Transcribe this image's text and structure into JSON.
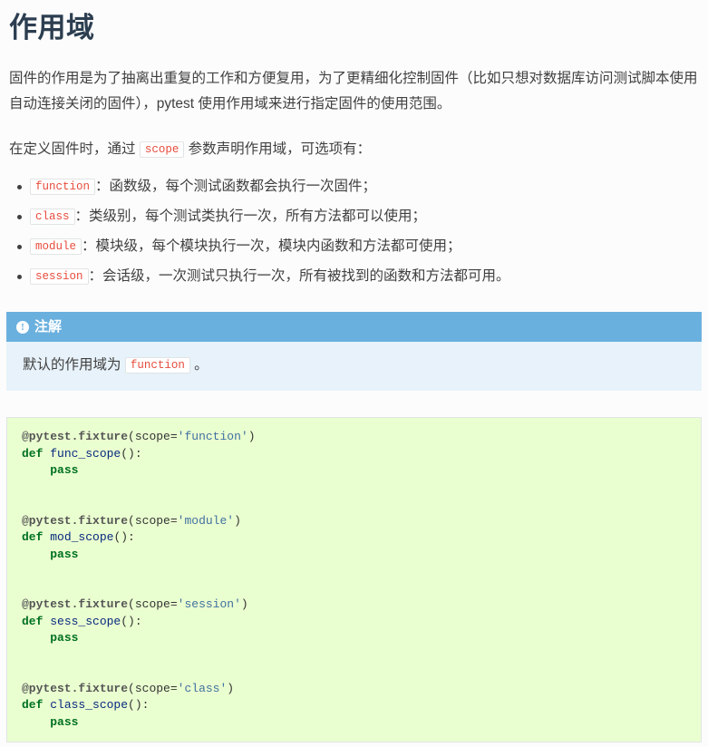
{
  "page": {
    "title": "作用域"
  },
  "intro": {
    "paragraph1": "固件的作用是为了抽离出重复的工作和方便复用，为了更精细化控制固件（比如只想对数据库访问测试脚本使用自动连接关闭的固件），pytest 使用作用域来进行指定固件的使用范围。",
    "paragraph2_before": "在定义固件时，通过",
    "paragraph2_code": "scope",
    "paragraph2_after": "参数声明作用域，可选项有："
  },
  "scope_list": [
    {
      "code": "function",
      "desc": "：函数级，每个测试函数都会执行一次固件；"
    },
    {
      "code": "class",
      "desc": "：类级别，每个测试类执行一次，所有方法都可以使用；"
    },
    {
      "code": "module",
      "desc": "：模块级，每个模块执行一次，模块内函数和方法都可使用；"
    },
    {
      "code": "session",
      "desc": "：会话级，一次测试只执行一次，所有被找到的函数和方法都可用。"
    }
  ],
  "note": {
    "icon": "exclamation-circle-icon",
    "title": "注解",
    "body_before": "默认的作用域为",
    "body_code": "function",
    "body_after": "。"
  },
  "code_block": {
    "language": "python",
    "lines": [
      {
        "tokens": [
          {
            "t": "@pytest.fixture",
            "k": "decorator"
          },
          {
            "t": "(",
            "k": "punct"
          },
          {
            "t": "scope",
            "k": "name"
          },
          {
            "t": "=",
            "k": "punct"
          },
          {
            "t": "'function'",
            "k": "string"
          },
          {
            "t": ")",
            "k": "punct"
          }
        ]
      },
      {
        "tokens": [
          {
            "t": "def",
            "k": "keyword"
          },
          {
            "t": " ",
            "k": "punct"
          },
          {
            "t": "func_scope",
            "k": "func"
          },
          {
            "t": "():",
            "k": "punct"
          }
        ]
      },
      {
        "tokens": [
          {
            "t": "    ",
            "k": "punct"
          },
          {
            "t": "pass",
            "k": "keyword"
          }
        ]
      },
      {
        "tokens": []
      },
      {
        "tokens": []
      },
      {
        "tokens": [
          {
            "t": "@pytest.fixture",
            "k": "decorator"
          },
          {
            "t": "(",
            "k": "punct"
          },
          {
            "t": "scope",
            "k": "name"
          },
          {
            "t": "=",
            "k": "punct"
          },
          {
            "t": "'module'",
            "k": "string"
          },
          {
            "t": ")",
            "k": "punct"
          }
        ]
      },
      {
        "tokens": [
          {
            "t": "def",
            "k": "keyword"
          },
          {
            "t": " ",
            "k": "punct"
          },
          {
            "t": "mod_scope",
            "k": "func"
          },
          {
            "t": "():",
            "k": "punct"
          }
        ]
      },
      {
        "tokens": [
          {
            "t": "    ",
            "k": "punct"
          },
          {
            "t": "pass",
            "k": "keyword"
          }
        ]
      },
      {
        "tokens": []
      },
      {
        "tokens": []
      },
      {
        "tokens": [
          {
            "t": "@pytest.fixture",
            "k": "decorator"
          },
          {
            "t": "(",
            "k": "punct"
          },
          {
            "t": "scope",
            "k": "name"
          },
          {
            "t": "=",
            "k": "punct"
          },
          {
            "t": "'session'",
            "k": "string"
          },
          {
            "t": ")",
            "k": "punct"
          }
        ]
      },
      {
        "tokens": [
          {
            "t": "def",
            "k": "keyword"
          },
          {
            "t": " ",
            "k": "punct"
          },
          {
            "t": "sess_scope",
            "k": "func"
          },
          {
            "t": "():",
            "k": "punct"
          }
        ]
      },
      {
        "tokens": [
          {
            "t": "    ",
            "k": "punct"
          },
          {
            "t": "pass",
            "k": "keyword"
          }
        ]
      },
      {
        "tokens": []
      },
      {
        "tokens": []
      },
      {
        "tokens": [
          {
            "t": "@pytest.fixture",
            "k": "decorator"
          },
          {
            "t": "(",
            "k": "punct"
          },
          {
            "t": "scope",
            "k": "name"
          },
          {
            "t": "=",
            "k": "punct"
          },
          {
            "t": "'class'",
            "k": "string"
          },
          {
            "t": ")",
            "k": "punct"
          }
        ]
      },
      {
        "tokens": [
          {
            "t": "def",
            "k": "keyword"
          },
          {
            "t": " ",
            "k": "punct"
          },
          {
            "t": "class_scope",
            "k": "func"
          },
          {
            "t": "():",
            "k": "punct"
          }
        ]
      },
      {
        "tokens": [
          {
            "t": "    ",
            "k": "punct"
          },
          {
            "t": "pass",
            "k": "keyword"
          }
        ]
      }
    ]
  },
  "colors": {
    "note_header": "#6ab0de",
    "note_body": "#e7f2fa",
    "code_background": "#eaffd0",
    "inline_code_text": "#e74c3c",
    "heading": "#2c3e50",
    "body_text": "#404040",
    "keyword": "#007020",
    "string": "#4070a0",
    "function_name": "#06287e"
  }
}
